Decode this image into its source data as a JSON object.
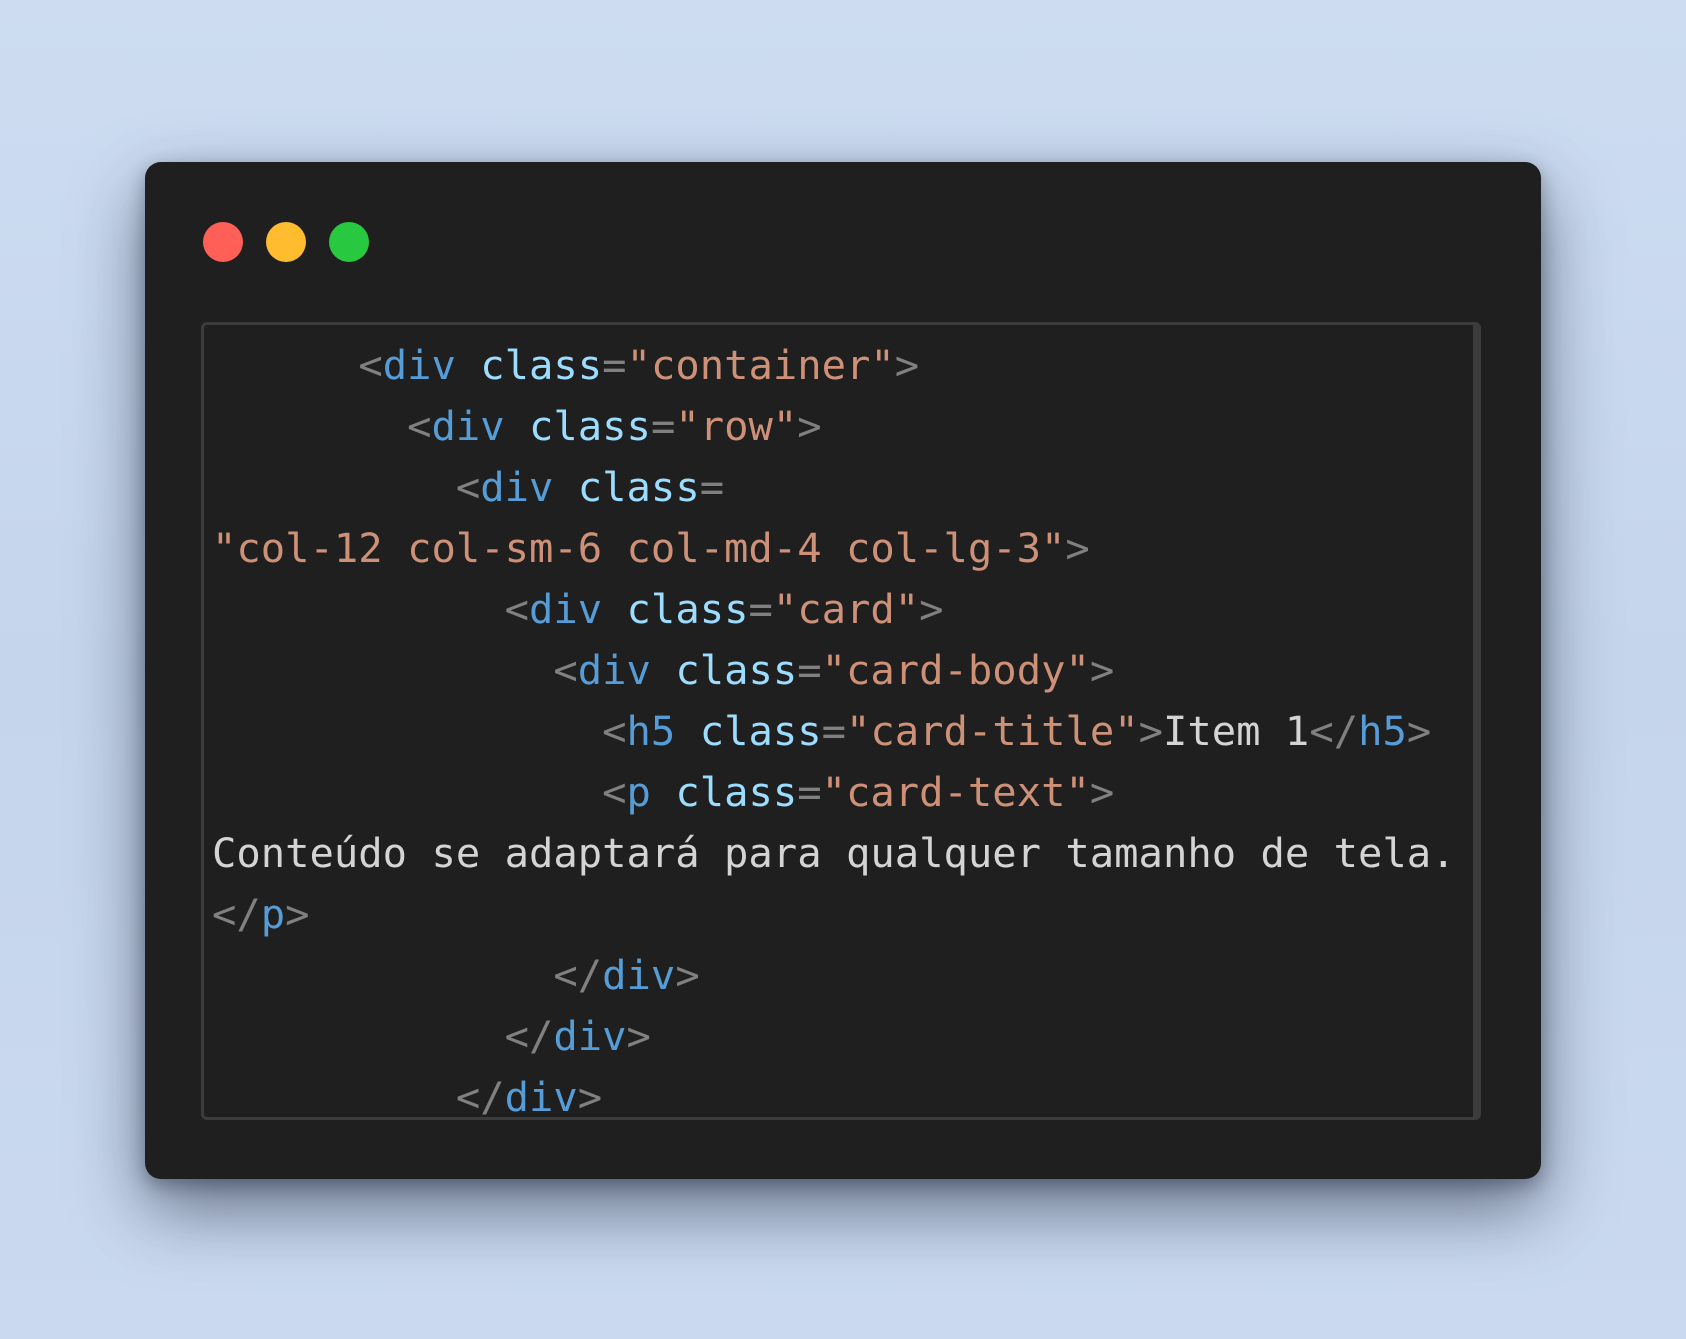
{
  "colors": {
    "window_bg": "#1f1f1f",
    "frame_border": "#3c3c3c",
    "close": "#fe5f57",
    "minimize": "#febc2e",
    "maximize": "#28c840",
    "punct": "#808080",
    "tag": "#569cd6",
    "attr": "#9cdcfe",
    "string": "#ce9178",
    "text": "#d4d4d4"
  },
  "window": {
    "controls": [
      {
        "name": "close",
        "icon": "red-dot-icon"
      },
      {
        "name": "minimize",
        "icon": "yellow-dot-icon"
      },
      {
        "name": "maximize",
        "icon": "green-dot-icon"
      }
    ]
  },
  "code": {
    "language": "html",
    "lines": [
      [
        [
          "",
          "      "
        ],
        [
          "punct",
          "<"
        ],
        [
          "tag",
          "div"
        ],
        [
          "text",
          " "
        ],
        [
          "attr",
          "class"
        ],
        [
          "punct",
          "="
        ],
        [
          "str",
          "\"container\""
        ],
        [
          "punct",
          ">"
        ]
      ],
      [
        [
          "",
          "        "
        ],
        [
          "punct",
          "<"
        ],
        [
          "tag",
          "div"
        ],
        [
          "text",
          " "
        ],
        [
          "attr",
          "class"
        ],
        [
          "punct",
          "="
        ],
        [
          "str",
          "\"row\""
        ],
        [
          "punct",
          ">"
        ]
      ],
      [
        [
          "",
          "          "
        ],
        [
          "punct",
          "<"
        ],
        [
          "tag",
          "div"
        ],
        [
          "text",
          " "
        ],
        [
          "attr",
          "class"
        ],
        [
          "punct",
          "="
        ]
      ],
      [
        [
          "str",
          "\"col-12 col-sm-6 col-md-4 col-lg-3\""
        ],
        [
          "punct",
          ">"
        ]
      ],
      [
        [
          "",
          "            "
        ],
        [
          "punct",
          "<"
        ],
        [
          "tag",
          "div"
        ],
        [
          "text",
          " "
        ],
        [
          "attr",
          "class"
        ],
        [
          "punct",
          "="
        ],
        [
          "str",
          "\"card\""
        ],
        [
          "punct",
          ">"
        ]
      ],
      [
        [
          "",
          "              "
        ],
        [
          "punct",
          "<"
        ],
        [
          "tag",
          "div"
        ],
        [
          "text",
          " "
        ],
        [
          "attr",
          "class"
        ],
        [
          "punct",
          "="
        ],
        [
          "str",
          "\"card-body\""
        ],
        [
          "punct",
          ">"
        ]
      ],
      [
        [
          "",
          "                "
        ],
        [
          "punct",
          "<"
        ],
        [
          "tag",
          "h5"
        ],
        [
          "text",
          " "
        ],
        [
          "attr",
          "class"
        ],
        [
          "punct",
          "="
        ],
        [
          "str",
          "\"card-title\""
        ],
        [
          "punct",
          ">"
        ],
        [
          "text",
          "Item 1"
        ],
        [
          "punct",
          "</"
        ],
        [
          "tag",
          "h5"
        ],
        [
          "punct",
          ">"
        ]
      ],
      [
        [
          "",
          "                "
        ],
        [
          "punct",
          "<"
        ],
        [
          "tag",
          "p"
        ],
        [
          "text",
          " "
        ],
        [
          "attr",
          "class"
        ],
        [
          "punct",
          "="
        ],
        [
          "str",
          "\"card-text\""
        ],
        [
          "punct",
          ">"
        ]
      ],
      [
        [
          "text",
          "Conteúdo se adaptará para qualquer tamanho de tela."
        ]
      ],
      [
        [
          "punct",
          "</"
        ],
        [
          "tag",
          "p"
        ],
        [
          "punct",
          ">"
        ]
      ],
      [
        [
          "",
          "              "
        ],
        [
          "punct",
          "</"
        ],
        [
          "tag",
          "div"
        ],
        [
          "punct",
          ">"
        ]
      ],
      [
        [
          "",
          "            "
        ],
        [
          "punct",
          "</"
        ],
        [
          "tag",
          "div"
        ],
        [
          "punct",
          ">"
        ]
      ],
      [
        [
          "",
          "          "
        ],
        [
          "punct",
          "</"
        ],
        [
          "tag",
          "div"
        ],
        [
          "punct",
          ">"
        ]
      ]
    ]
  }
}
